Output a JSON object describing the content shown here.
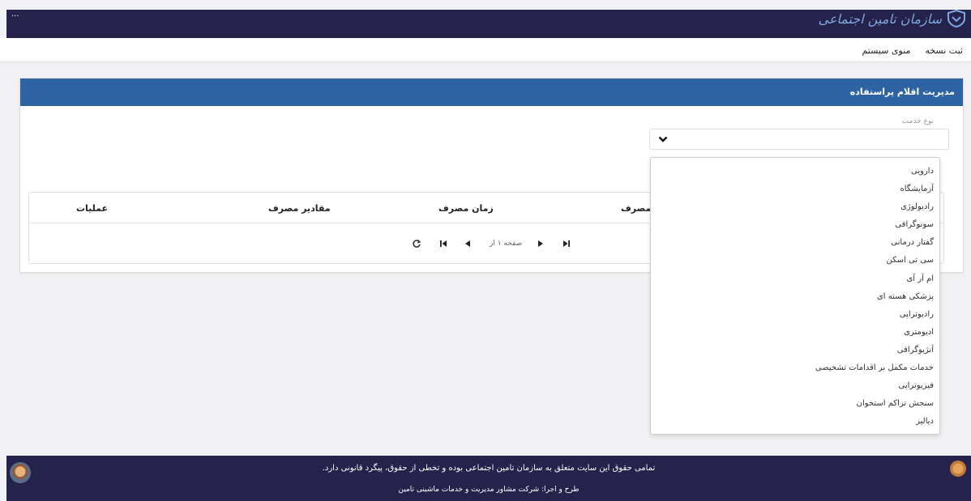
{
  "header": {
    "logo_text": "سازمان تامین اجتماعی",
    "user_text": "...",
    "colors": {
      "bar": "#25224c",
      "logo": "#7fa8de"
    }
  },
  "menu": {
    "items": [
      "منوی سیستم",
      "ثبت نسخه"
    ]
  },
  "panel": {
    "title": "مدیریت اقلام پراستفاده",
    "service_type_label": "نوع خدمت",
    "header_color": "#2d63a2"
  },
  "table": {
    "columns": [
      "طریقه مصرف",
      "زمان مصرف",
      "مقادیر مصرف",
      "عملیات"
    ],
    "pager_text": "صفحه ۱ از"
  },
  "dropdown": {
    "options": [
      "دارویی",
      "آزمایشگاه",
      "رادیولوژی",
      "سونوگرافی",
      "گفتار درمانی",
      "سی تی اسکن",
      "ام آر آی",
      "پزشکی هسته ای",
      "رادیوتراپی",
      "ادیومتری",
      "آنژیوگرافی",
      "خدمات مکمل بر اقدامات تشخیصی",
      "فیزیوتراپی",
      "سنجش تراکم استخوان",
      "دیالیز"
    ]
  },
  "footer": {
    "copyright": "تمامی حقوق این سایت متعلق به سازمان تامین اجتماعی بوده و تخطی از حقوق، پیگرد قانونی دارد.",
    "credit": "طرح و اجرا: شرکت مشاور مدیریت و خدمات ماشینی تامین"
  }
}
